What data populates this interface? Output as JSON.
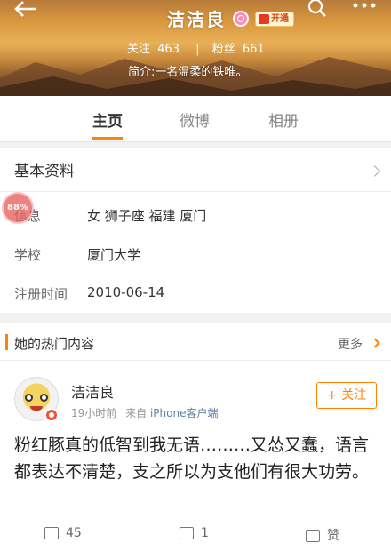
{
  "header": {
    "username": "洁洁良",
    "vip_badge": "开通",
    "follow_label": "关注",
    "follow_count": "463",
    "fans_label": "粉丝",
    "fans_count": "661",
    "bio": "简介:一名温柔的铁唯。",
    "icons": [
      "back-icon",
      "search-icon",
      "more-icon"
    ]
  },
  "tabs": [
    {
      "label": "主页",
      "active": true
    },
    {
      "label": "微博",
      "active": false
    },
    {
      "label": "相册",
      "active": false
    }
  ],
  "basic_info": {
    "title": "基本资料",
    "rows": [
      {
        "label": "信息",
        "value": "女 狮子座 福建 厦门"
      },
      {
        "label": "学校",
        "value": "厦门大学"
      },
      {
        "label": "注册时间",
        "value": "2010-06-14"
      }
    ],
    "progress_badge": "88%"
  },
  "hot": {
    "title": "她的热门内容",
    "more": "更多"
  },
  "post": {
    "user": "洁洁良",
    "time": "19小时前",
    "from_label": "来自",
    "source": "iPhone客户端",
    "follow_button": "+ 关注",
    "text": "粉红豚真的低智到我无语………又怂又蠢，语言都表达不清楚，支之所以为支他们有很大功劳。",
    "reposts": "45",
    "comments": "1",
    "likes": "赞"
  },
  "colors": {
    "accent": "#ff8200",
    "link": "#5d7fa6"
  }
}
